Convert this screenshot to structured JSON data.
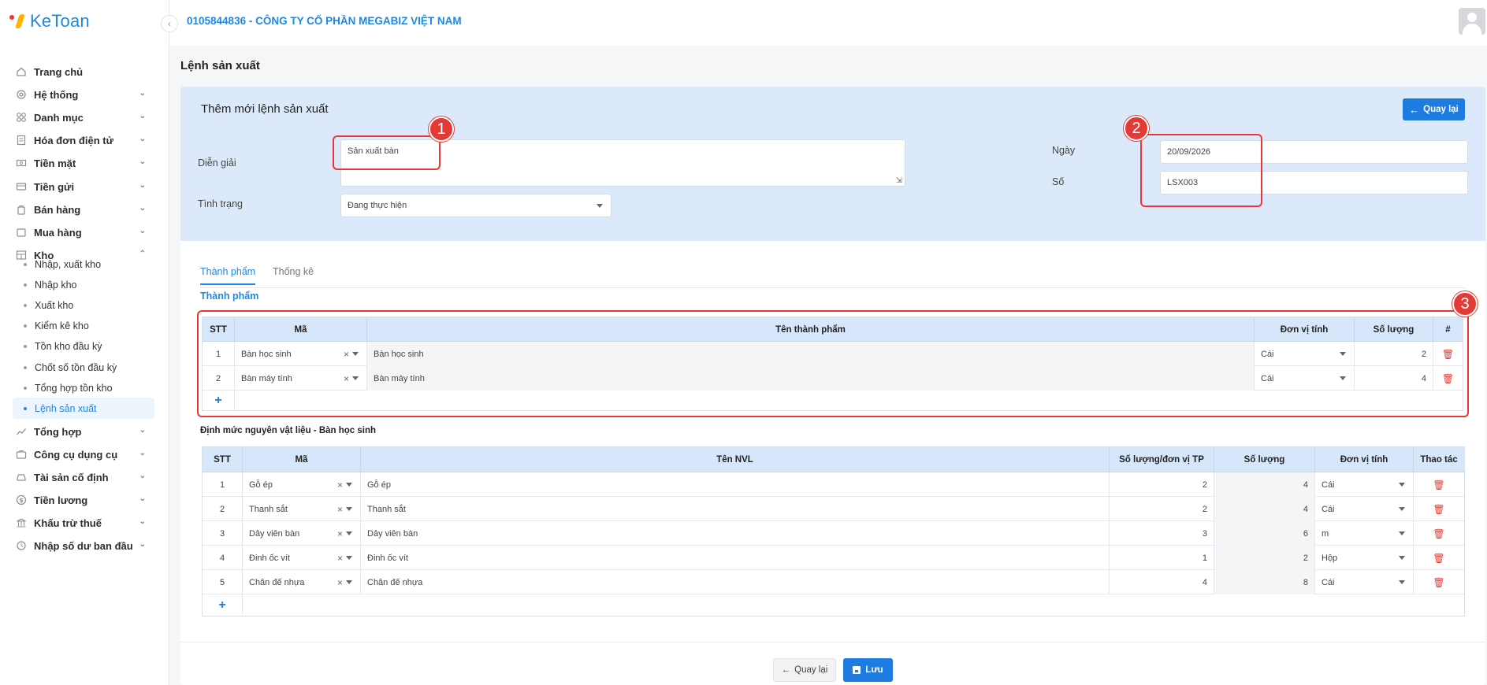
{
  "app": {
    "logo": "KeToan"
  },
  "topbar": {
    "company": "0105844836 - CÔNG TY CỔ PHẦN MEGABIZ VIỆT NAM"
  },
  "sidebar": {
    "items": [
      {
        "label": "Trang chủ",
        "icon": "home-icon"
      },
      {
        "label": "Hệ thống",
        "icon": "gear-icon"
      },
      {
        "label": "Danh mục",
        "icon": "grid-icon"
      },
      {
        "label": "Hóa đơn điện tử",
        "icon": "invoice-icon"
      },
      {
        "label": "Tiền mặt",
        "icon": "cash-icon"
      },
      {
        "label": "Tiền gửi",
        "icon": "card-icon"
      },
      {
        "label": "Bán hàng",
        "icon": "bag-icon"
      },
      {
        "label": "Mua hàng",
        "icon": "cart-icon"
      },
      {
        "label": "Kho",
        "icon": "warehouse-icon"
      },
      {
        "label": "Tổng hợp",
        "icon": "chart-icon"
      },
      {
        "label": "Công cụ dụng cụ",
        "icon": "tool-icon"
      },
      {
        "label": "Tài sản cố định",
        "icon": "car-icon"
      },
      {
        "label": "Tiền lương",
        "icon": "dollar-icon"
      },
      {
        "label": "Khấu trừ thuế",
        "icon": "bank-icon"
      },
      {
        "label": "Nhập số dư ban đầu",
        "icon": "refresh-icon"
      }
    ],
    "kho_sub": [
      "Nhập, xuất kho",
      "Nhập kho",
      "Xuất kho",
      "Kiểm kê kho",
      "Tồn kho đầu kỳ",
      "Chốt số tồn đầu kỳ",
      "Tổng hợp tồn kho",
      "Lệnh sản xuất"
    ]
  },
  "page": {
    "title": "Lệnh sản xuất"
  },
  "form": {
    "title": "Thêm mới lệnh sản xuất",
    "back_label": "Quay lại",
    "dien_giai_label": "Diễn giải",
    "dien_giai_value": "Sản xuất bàn",
    "tinh_trang_label": "Tình trạng",
    "tinh_trang_value": "Đang thực hiện",
    "ngay_label": "Ngày",
    "ngay_value": "20/09/2026",
    "so_label": "Số",
    "so_value": "LSX003"
  },
  "callouts": [
    "1",
    "2",
    "3"
  ],
  "tabs": [
    "Thành phẩm",
    "Thống kê"
  ],
  "products": {
    "section_title": "Thành phẩm",
    "headers": [
      "STT",
      "Mã",
      "Tên thành phẩm",
      "Đơn vị tính",
      "Số lượng",
      "#"
    ],
    "rows": [
      {
        "stt": "1",
        "ma": "Bàn học sinh",
        "ten": "Bàn học sinh",
        "dvt": "Cái",
        "sl": "2"
      },
      {
        "stt": "2",
        "ma": "Bàn máy tính",
        "ten": "Bàn máy tính",
        "dvt": "Cái",
        "sl": "4"
      }
    ]
  },
  "materials": {
    "section_title": "Định mức nguyên vật liệu - Bàn học sinh",
    "headers": [
      "STT",
      "Mã",
      "Tên NVL",
      "Số lượng/đơn vị TP",
      "Số lượng",
      "Đơn vị tính",
      "Thao tác"
    ],
    "rows": [
      {
        "stt": "1",
        "ma": "Gỗ ép",
        "ten": "Gỗ ép",
        "sl_tp": "2",
        "sl": "4",
        "dvt": "Cái"
      },
      {
        "stt": "2",
        "ma": "Thanh sắt",
        "ten": "Thanh sắt",
        "sl_tp": "2",
        "sl": "4",
        "dvt": "Cái"
      },
      {
        "stt": "3",
        "ma": "Dây viên bàn",
        "ten": "Dây viên bàn",
        "sl_tp": "3",
        "sl": "6",
        "dvt": "m"
      },
      {
        "stt": "4",
        "ma": "Đinh ốc vít",
        "ten": "Đinh ốc vít",
        "sl_tp": "1",
        "sl": "2",
        "dvt": "Hộp"
      },
      {
        "stt": "5",
        "ma": "Chân đế nhựa",
        "ten": "Chân đế nhựa",
        "sl_tp": "4",
        "sl": "8",
        "dvt": "Cái"
      }
    ]
  },
  "footer": {
    "back_label": "Quay lại",
    "save_label": "Lưu"
  },
  "colors": {
    "accent": "#1e7be0",
    "callout": "#e53935",
    "header_bg": "#dbe9fb"
  }
}
